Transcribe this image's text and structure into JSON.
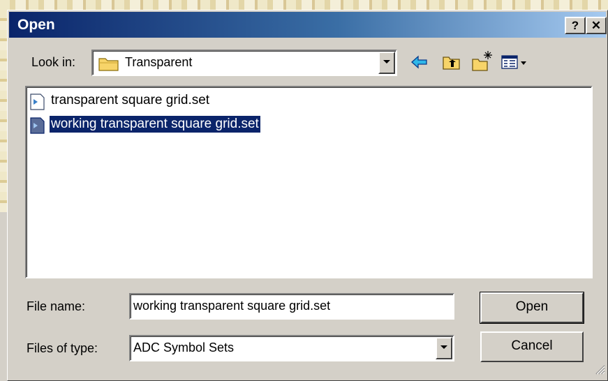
{
  "window": {
    "title": "Open",
    "help_label": "?",
    "close_label": "✕"
  },
  "look_in": {
    "label": "Look in:",
    "value": "Transparent"
  },
  "toolbar": {
    "back_icon": "back-arrow-icon",
    "up_icon": "up-folder-icon",
    "new_folder_icon": "new-folder-icon",
    "view_menu_icon": "view-menu-icon"
  },
  "files": [
    {
      "name": "transparent square grid.set",
      "selected": false
    },
    {
      "name": "working transparent square grid.set",
      "selected": true
    }
  ],
  "file_name": {
    "label": "File name:",
    "value": "working transparent square grid.set"
  },
  "file_type": {
    "label": "Files of type:",
    "value": "ADC Symbol Sets"
  },
  "buttons": {
    "open": "Open",
    "cancel": "Cancel"
  },
  "colors": {
    "title_start": "#0a246a",
    "title_end": "#a6caf0",
    "face": "#d4d0c8",
    "selection": "#0a246a"
  }
}
